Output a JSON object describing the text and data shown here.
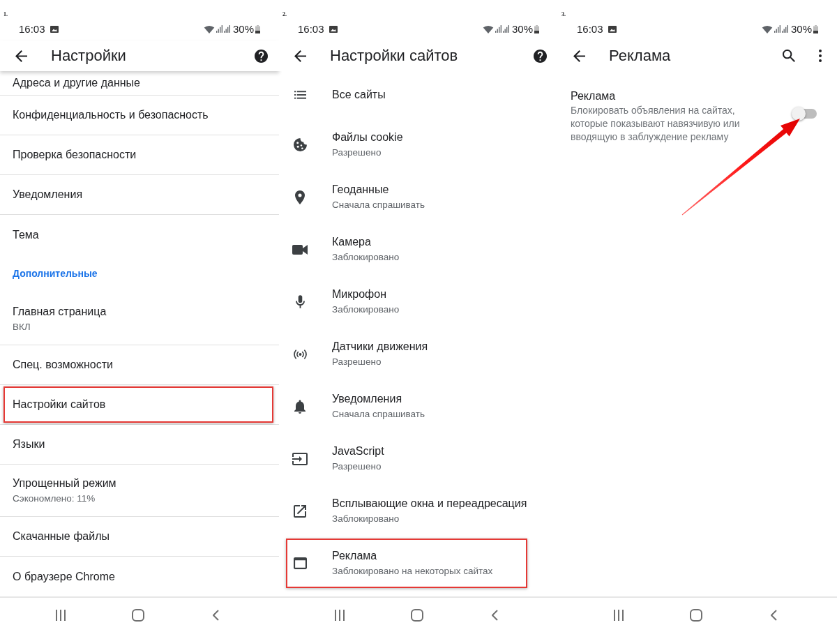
{
  "screens": [
    {
      "step": "1.",
      "status_bar": {
        "time": "16:03",
        "battery": "30%"
      },
      "toolbar": {
        "title": "Настройки",
        "elevated": true,
        "actions": [
          {
            "kind": "help"
          }
        ]
      },
      "list": [
        {
          "kind": "setting",
          "title": "Адреса и другие данные",
          "highlighted": false
        },
        {
          "kind": "setting",
          "title": "Конфиденциальность и безопасность",
          "highlighted": false
        },
        {
          "kind": "setting",
          "title": "Проверка безопасности",
          "highlighted": false
        },
        {
          "kind": "setting",
          "title": "Уведомления",
          "highlighted": false
        },
        {
          "kind": "setting",
          "title": "Тема",
          "highlighted": false
        },
        {
          "kind": "section",
          "title": "Дополнительные",
          "highlighted": false
        },
        {
          "kind": "setting",
          "title": "Главная страница",
          "subtitle": "ВКЛ",
          "highlighted": false
        },
        {
          "kind": "setting",
          "title": "Спец. возможности",
          "highlighted": false
        },
        {
          "kind": "setting",
          "title": "Настройки сайтов",
          "highlighted": true
        },
        {
          "kind": "setting",
          "title": "Языки",
          "highlighted": false
        },
        {
          "kind": "setting",
          "title": "Упрощенный режим",
          "subtitle": "Сэкономлено: 11%",
          "highlighted": false
        },
        {
          "kind": "setting",
          "title": "Скачанные файлы",
          "highlighted": false
        },
        {
          "kind": "setting",
          "title": "О браузере Chrome",
          "highlighted": false
        }
      ]
    },
    {
      "step": "2.",
      "status_bar": {
        "time": "16:03",
        "battery": "30%"
      },
      "toolbar": {
        "title": "Настройки сайтов",
        "elevated": false,
        "actions": [
          {
            "kind": "help"
          }
        ]
      },
      "list": [
        {
          "kind": "list",
          "title": "Все сайты",
          "highlighted": false
        },
        {
          "kind": "cookie",
          "title": "Файлы cookie",
          "subtitle": "Разрешено",
          "highlighted": false
        },
        {
          "kind": "pin",
          "title": "Геоданные",
          "subtitle": "Сначала спрашивать",
          "highlighted": false
        },
        {
          "kind": "camera",
          "title": "Камера",
          "subtitle": "Заблокировано",
          "highlighted": false
        },
        {
          "kind": "mic",
          "title": "Микрофон",
          "subtitle": "Заблокировано",
          "highlighted": false
        },
        {
          "kind": "sensors",
          "title": "Датчики движения",
          "subtitle": "Разрешено",
          "highlighted": false
        },
        {
          "kind": "bell",
          "title": "Уведомления",
          "subtitle": "Сначала спрашивать",
          "highlighted": false
        },
        {
          "kind": "input",
          "title": "JavaScript",
          "subtitle": "Разрешено",
          "highlighted": false
        },
        {
          "kind": "popup",
          "title": "Всплывающие окна и переадресация",
          "subtitle": "Заблокировано",
          "highlighted": false
        },
        {
          "kind": "window",
          "title": "Реклама",
          "subtitle": "Заблокировано на некоторых сайтах",
          "highlighted": true
        }
      ]
    },
    {
      "step": "3.",
      "status_bar": {
        "time": "16:03",
        "battery": "30%"
      },
      "toolbar": {
        "title": "Реклама",
        "elevated": false,
        "actions": [
          {
            "kind": "search"
          },
          {
            "kind": "more"
          }
        ]
      },
      "list": [
        {
          "kind": "toggle",
          "title": "Реклама",
          "description": "Блокировать объявления на сайтах, которые показывают навязчивую или вводящую в заблуждение рекламу",
          "on": false,
          "highlighted": true
        }
      ]
    }
  ]
}
